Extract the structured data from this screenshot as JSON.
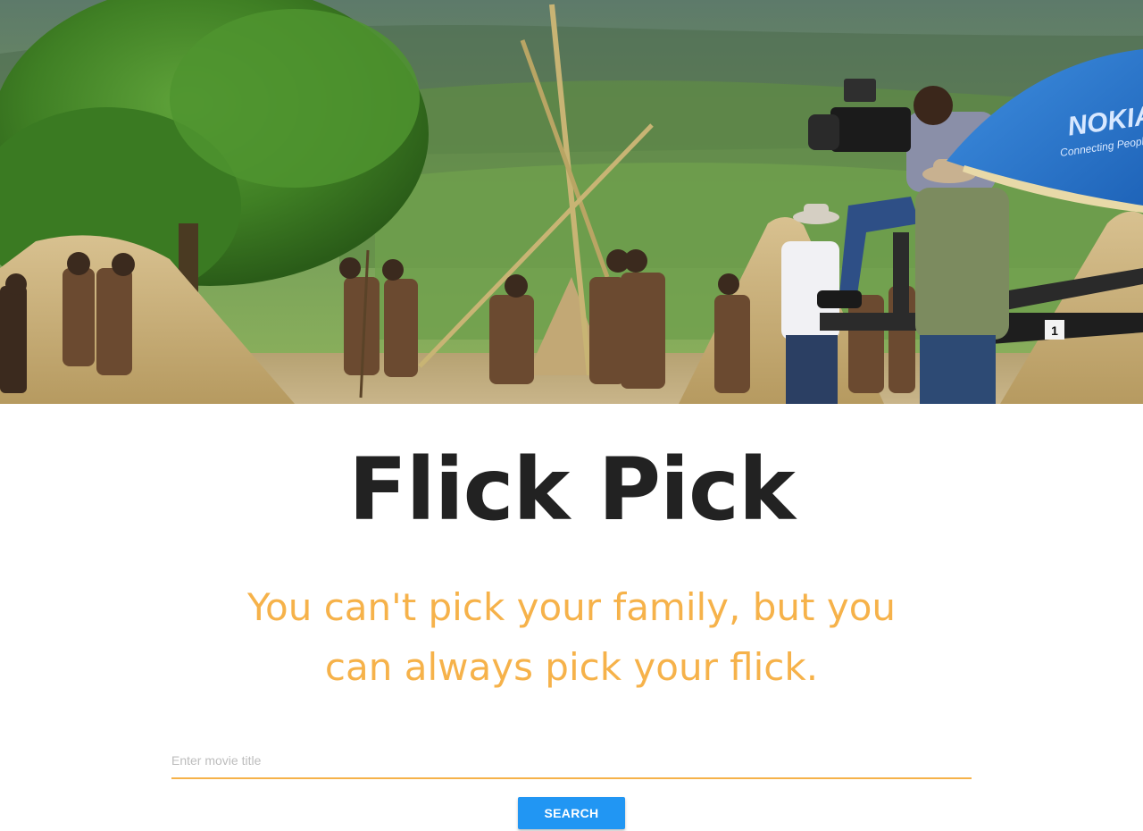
{
  "hero": {
    "umbrella_text": "NOKIA",
    "umbrella_subtext": "Connecting People",
    "crane_label": "1"
  },
  "title": "Flick Pick",
  "tagline": "You can't pick your family, but you can always pick your flick.",
  "search": {
    "placeholder": "Enter movie title",
    "value": "",
    "button_label": "SEARCH"
  },
  "colors": {
    "accent": "#f6b24a",
    "button": "#2196f3",
    "title": "#222222"
  }
}
